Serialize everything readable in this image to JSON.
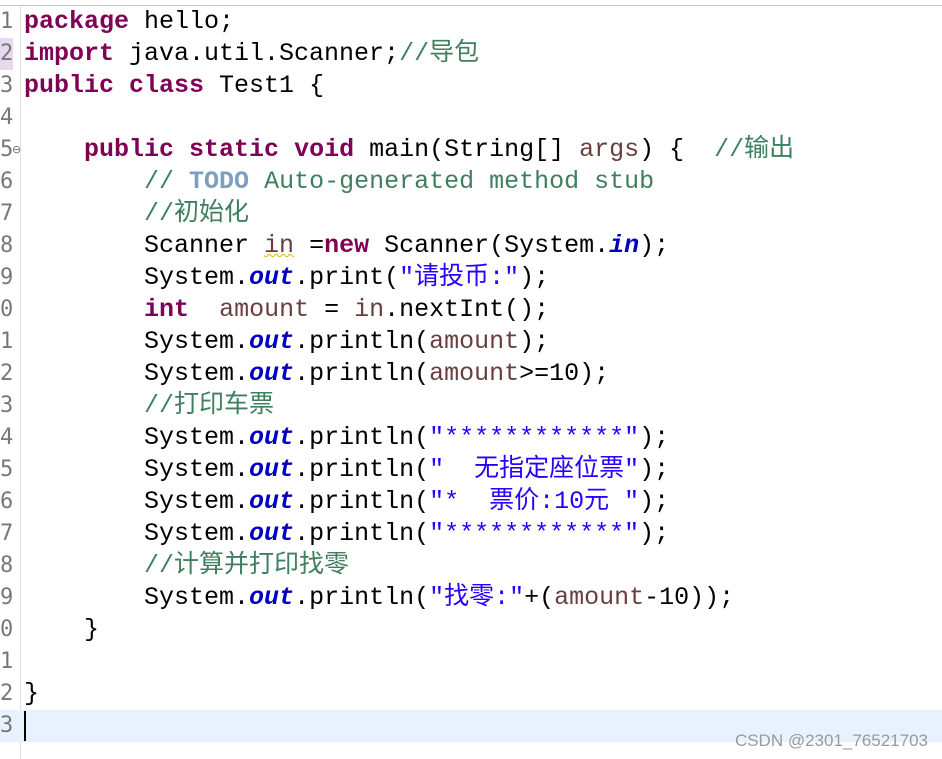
{
  "editor": {
    "lines": [
      {
        "num": "1",
        "code": [
          {
            "t": "kw",
            "v": "package"
          },
          {
            "t": "",
            "v": " hello;"
          }
        ]
      },
      {
        "num": "2",
        "code": [
          {
            "t": "kw",
            "v": "import"
          },
          {
            "t": "",
            "v": " java.util.Scanner;"
          },
          {
            "t": "cm",
            "v": "//导包"
          }
        ]
      },
      {
        "num": "3",
        "code": [
          {
            "t": "kw",
            "v": "public"
          },
          {
            "t": "",
            "v": " "
          },
          {
            "t": "kw",
            "v": "class"
          },
          {
            "t": "",
            "v": " Test1 {"
          }
        ]
      },
      {
        "num": "4",
        "code": []
      },
      {
        "num": "5",
        "code": [
          {
            "t": "",
            "v": "    "
          },
          {
            "t": "kw",
            "v": "public"
          },
          {
            "t": "",
            "v": " "
          },
          {
            "t": "kw",
            "v": "static"
          },
          {
            "t": "",
            "v": " "
          },
          {
            "t": "kw",
            "v": "void"
          },
          {
            "t": "",
            "v": " main(String[] "
          },
          {
            "t": "var",
            "v": "args"
          },
          {
            "t": "",
            "v": ") {  "
          },
          {
            "t": "cm",
            "v": "//输出"
          }
        ]
      },
      {
        "num": "6",
        "code": [
          {
            "t": "",
            "v": "        "
          },
          {
            "t": "cm",
            "v": "// "
          },
          {
            "t": "task",
            "v": "TODO"
          },
          {
            "t": "cm",
            "v": " Auto-generated method stub"
          }
        ]
      },
      {
        "num": "7",
        "code": [
          {
            "t": "",
            "v": "        "
          },
          {
            "t": "cm",
            "v": "//初始化"
          }
        ]
      },
      {
        "num": "8",
        "code": [
          {
            "t": "",
            "v": "        Scanner "
          },
          {
            "t": "var warn",
            "v": "in"
          },
          {
            "t": "",
            "v": " ="
          },
          {
            "t": "kw",
            "v": "new"
          },
          {
            "t": "",
            "v": " Scanner(System."
          },
          {
            "t": "fld",
            "v": "in"
          },
          {
            "t": "",
            "v": ");"
          }
        ]
      },
      {
        "num": "9",
        "code": [
          {
            "t": "",
            "v": "        System."
          },
          {
            "t": "fld",
            "v": "out"
          },
          {
            "t": "",
            "v": ".print("
          },
          {
            "t": "str",
            "v": "\"请投币:\""
          },
          {
            "t": "",
            "v": ");"
          }
        ]
      },
      {
        "num": "0",
        "code": [
          {
            "t": "",
            "v": "        "
          },
          {
            "t": "kw",
            "v": "int"
          },
          {
            "t": "",
            "v": "  "
          },
          {
            "t": "var",
            "v": "amount"
          },
          {
            "t": "",
            "v": " = "
          },
          {
            "t": "var",
            "v": "in"
          },
          {
            "t": "",
            "v": ".nextInt();"
          }
        ]
      },
      {
        "num": "1",
        "code": [
          {
            "t": "",
            "v": "        System."
          },
          {
            "t": "fld",
            "v": "out"
          },
          {
            "t": "",
            "v": ".println("
          },
          {
            "t": "var",
            "v": "amount"
          },
          {
            "t": "",
            "v": ");"
          }
        ]
      },
      {
        "num": "2",
        "code": [
          {
            "t": "",
            "v": "        System."
          },
          {
            "t": "fld",
            "v": "out"
          },
          {
            "t": "",
            "v": ".println("
          },
          {
            "t": "var",
            "v": "amount"
          },
          {
            "t": "",
            "v": ">=10);"
          }
        ]
      },
      {
        "num": "3",
        "code": [
          {
            "t": "",
            "v": "        "
          },
          {
            "t": "cm",
            "v": "//打印车票"
          }
        ]
      },
      {
        "num": "4",
        "code": [
          {
            "t": "",
            "v": "        System."
          },
          {
            "t": "fld",
            "v": "out"
          },
          {
            "t": "",
            "v": ".println("
          },
          {
            "t": "str",
            "v": "\"************\""
          },
          {
            "t": "",
            "v": ");"
          }
        ]
      },
      {
        "num": "5",
        "code": [
          {
            "t": "",
            "v": "        System."
          },
          {
            "t": "fld",
            "v": "out"
          },
          {
            "t": "",
            "v": ".println("
          },
          {
            "t": "str",
            "v": "\"  无指定座位票\""
          },
          {
            "t": "",
            "v": ");"
          }
        ]
      },
      {
        "num": "6",
        "code": [
          {
            "t": "",
            "v": "        System."
          },
          {
            "t": "fld",
            "v": "out"
          },
          {
            "t": "",
            "v": ".println("
          },
          {
            "t": "str",
            "v": "\"*  票价:10元 \""
          },
          {
            "t": "",
            "v": ");"
          }
        ]
      },
      {
        "num": "7",
        "code": [
          {
            "t": "",
            "v": "        System."
          },
          {
            "t": "fld",
            "v": "out"
          },
          {
            "t": "",
            "v": ".println("
          },
          {
            "t": "str",
            "v": "\"************\""
          },
          {
            "t": "",
            "v": ");"
          }
        ]
      },
      {
        "num": "8",
        "code": [
          {
            "t": "",
            "v": "        "
          },
          {
            "t": "cm",
            "v": "//计算并打印找零"
          }
        ]
      },
      {
        "num": "9",
        "code": [
          {
            "t": "",
            "v": "        System."
          },
          {
            "t": "fld",
            "v": "out"
          },
          {
            "t": "",
            "v": ".println("
          },
          {
            "t": "str",
            "v": "\"找零:\""
          },
          {
            "t": "",
            "v": "+("
          },
          {
            "t": "var",
            "v": "amount"
          },
          {
            "t": "",
            "v": "-10));"
          }
        ]
      },
      {
        "num": "0",
        "code": [
          {
            "t": "",
            "v": "    }"
          }
        ]
      },
      {
        "num": "1",
        "code": []
      },
      {
        "num": "2",
        "code": [
          {
            "t": "",
            "v": "}"
          }
        ]
      },
      {
        "num": "3",
        "code": []
      }
    ],
    "current_line": 23,
    "marked_line": 2,
    "fold_line": 5,
    "fold_glyph": "⊖",
    "colors": {
      "keyword": "#7f0055",
      "comment": "#3f7f5f",
      "task_tag": "#7f9fbf",
      "string": "#2a00ff",
      "static_field": "#0000c0",
      "local_variable": "#6a3e3e",
      "current_line_bg": "#e8f2fe"
    }
  },
  "watermark": "CSDN @2301_76521703"
}
